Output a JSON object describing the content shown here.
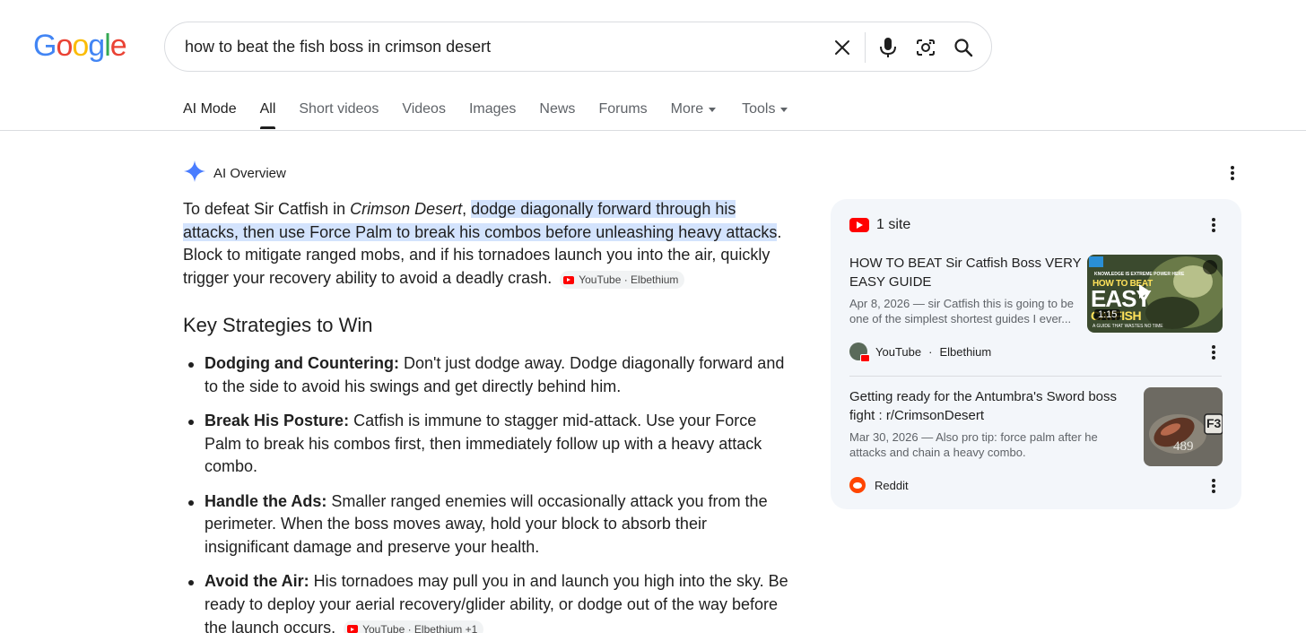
{
  "logo": {
    "letters": [
      "G",
      "o",
      "o",
      "g",
      "l",
      "e"
    ],
    "colors": [
      "#4285F4",
      "#EA4335",
      "#FBBC05",
      "#4285F4",
      "#34A853",
      "#EA4335"
    ]
  },
  "search": {
    "query": "how to beat the fish boss in crimson desert"
  },
  "tabs": [
    {
      "label": "AI Mode"
    },
    {
      "label": "All"
    },
    {
      "label": "Short videos"
    },
    {
      "label": "Videos"
    },
    {
      "label": "Images"
    },
    {
      "label": "News"
    },
    {
      "label": "Forums"
    },
    {
      "label": "More"
    },
    {
      "label": "Tools"
    }
  ],
  "ai_overview": {
    "label": "AI Overview",
    "intro_plain": "To defeat Sir Catfish in ",
    "intro_italic": "Crimson Desert",
    "intro_comma": ", ",
    "intro_highlight": "dodge diagonally forward through his attacks, then use Force Palm to break his combos before unleashing heavy attacks",
    "intro_rest": ". Block to mitigate ranged mobs, and if his tornadoes launch you into the air, quickly trigger your recovery ability to avoid a deadly crash.",
    "intro_cite": "YouTube · Elbethium",
    "heading": "Key Strategies to Win",
    "bullets": [
      {
        "title": "Dodging and Countering:",
        "text": " Don't just dodge away. Dodge diagonally forward and to the side to avoid his swings and get directly behind him.",
        "cite": ""
      },
      {
        "title": "Break His Posture:",
        "text": " Catfish is immune to stagger mid-attack. Use your Force Palm to break his combos first, then immediately follow up with a heavy attack combo.",
        "cite": ""
      },
      {
        "title": "Handle the Ads:",
        "text": " Smaller ranged enemies will occasionally attack you from the perimeter. When the boss moves away, hold your block to absorb their insignificant damage and preserve your health.",
        "cite": ""
      },
      {
        "title": "Avoid the Air:",
        "text": " His tornadoes may pull you in and launch you high into the sky. Be ready to deploy your aerial recovery/glider ability, or dodge out of the way before the launch occurs.",
        "cite": "YouTube · Elbethium +1"
      }
    ]
  },
  "sources": {
    "count_label": "1 site",
    "cards": [
      {
        "title": "HOW TO BEAT Sir Catfish Boss VERY EASY GUIDE",
        "snippet": "Apr 8, 2026 — sir Catfish this is going to be one of the simplest shortest guides I ever...",
        "source": "YouTube",
        "author": "Elbethium",
        "duration": "1:15",
        "thumb_text_top": "KNOWLEDGE IS EXTREME POWER HERE",
        "thumb_text_main": "HOW TO BEAT",
        "thumb_text_big": "EASY",
        "thumb_text_fish": "CATFISH",
        "thumb_text_bottom": "A GUIDE THAT WASTES NO TIME"
      },
      {
        "title": "Getting ready for the Antumbra's Sword boss fight : r/CrimsonDesert",
        "snippet": "Mar 30, 2026 — Also pro tip: force palm after he attacks and chain a heavy combo.",
        "source": "Reddit",
        "thumb_key": "F3",
        "thumb_number": "489"
      }
    ]
  }
}
